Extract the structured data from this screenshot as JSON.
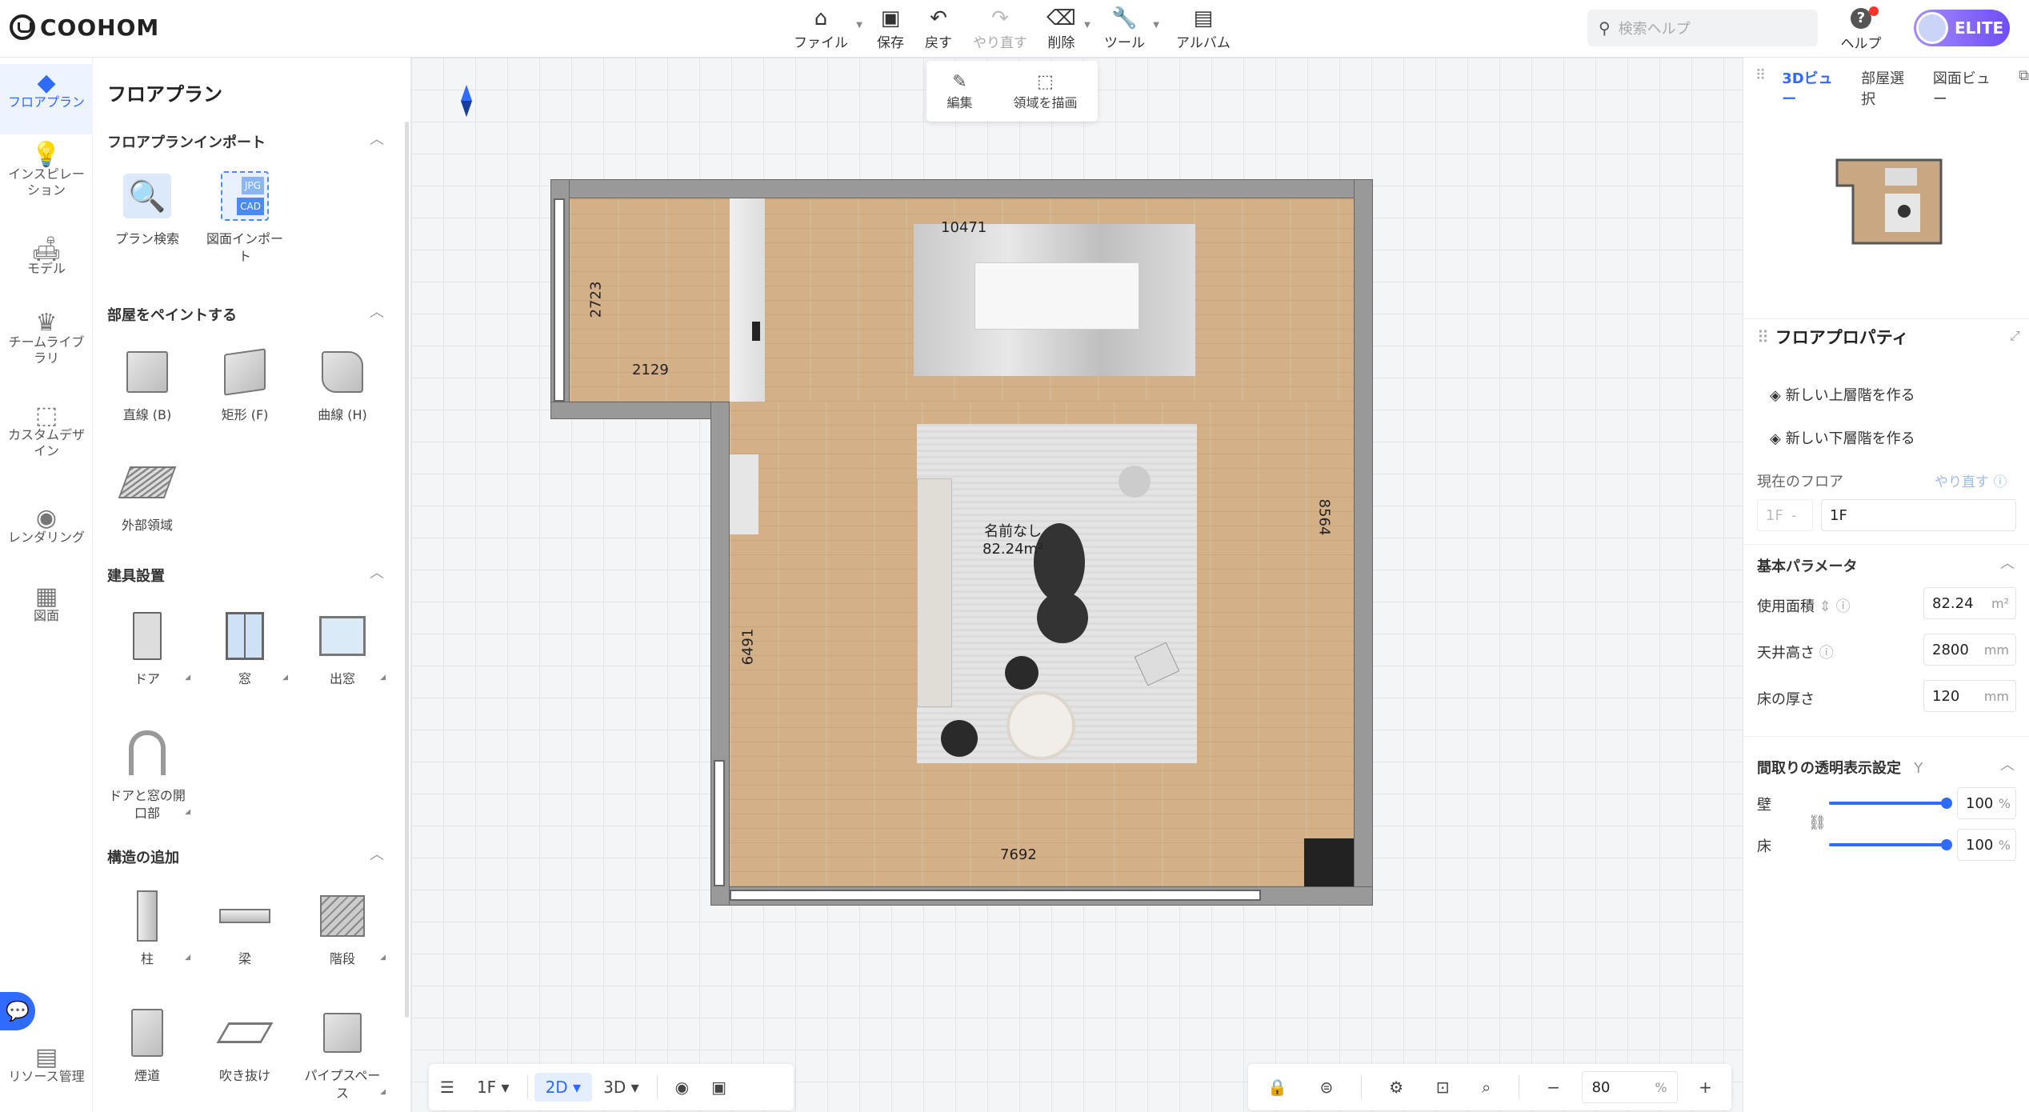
{
  "brand": "COOHOM",
  "toolbar": {
    "file": "ファイル",
    "save": "保存",
    "undo": "戻す",
    "redo": "やり直す",
    "delete": "削除",
    "tools": "ツール",
    "album": "アルバム"
  },
  "search": {
    "placeholder": "検索ヘルプ"
  },
  "help": "ヘルプ",
  "badge": "ELITE",
  "rail": [
    {
      "label": "フロアプラン",
      "icon": "floorplan-icon"
    },
    {
      "label": "インスピレーション",
      "icon": "lightbulb-icon"
    },
    {
      "label": "モデル",
      "icon": "sofa-icon"
    },
    {
      "label": "チームライブラリ",
      "icon": "crown-icon"
    },
    {
      "label": "カスタムデザイン",
      "icon": "box-icon"
    },
    {
      "label": "レンダリング",
      "icon": "camera-icon"
    },
    {
      "label": "図面",
      "icon": "drawing-icon"
    },
    {
      "label": "リソース管理",
      "icon": "resource-icon"
    }
  ],
  "panel": {
    "title": "フロアプラン",
    "import_section": "フロアプランインポート",
    "plan_search": "プラン検索",
    "drawing_import": "図面インポート",
    "paint_section": "部屋をペイントする",
    "straight": "直線 (B)",
    "rect": "矩形 (F)",
    "curve": "曲線 (H)",
    "exterior": "外部領域",
    "fixtures_section": "建具設置",
    "door": "ドア",
    "window": "窓",
    "bay_window": "出窓",
    "opening": "ドアと窓の開口部",
    "structure_section": "構造の追加",
    "column": "柱",
    "beam": "梁",
    "stairs": "階段",
    "chimney": "煙道",
    "void": "吹き抜け",
    "pipe_space": "パイプスペース"
  },
  "float_toolbar": {
    "edit": "編集",
    "draw_area": "領域を描画"
  },
  "plan": {
    "dims": {
      "top": "10471",
      "left_small": "2723",
      "ledge": "2129",
      "right": "8564",
      "left_large": "6491",
      "bottom": "7692"
    },
    "room_name": "名前なし",
    "room_area": "82.24m²"
  },
  "bottom_left": {
    "floor": "1F",
    "mode_2d": "2D",
    "mode_3d": "3D"
  },
  "zoom": {
    "value": "80",
    "unit": "%"
  },
  "right_panel": {
    "tabs": [
      "3Dビュー",
      "部屋選択",
      "図面ビュー"
    ],
    "title": "フロアプロパティ",
    "new_upper": "新しい上層階を作る",
    "new_lower": "新しい下層階を作る",
    "current_floor_label": "現在のフロア",
    "redo_link": "やり直す",
    "floor_code": "1F",
    "floor_dash": "-",
    "floor_value": "1F",
    "basic_params": "基本パラメータ",
    "area_label": "使用面積",
    "area_value": "82.24",
    "area_unit": "m²",
    "ceiling_label": "天井高さ",
    "ceiling_value": "2800",
    "ceiling_unit": "mm",
    "floor_thick_label": "床の厚さ",
    "floor_thick_value": "120",
    "floor_thick_unit": "mm",
    "transparency": "間取りの透明表示設定",
    "transparency_suffix": "Y",
    "wall_label": "壁",
    "wall_value": "100",
    "floor_label": "床",
    "floor_value2": "100",
    "percent": "%"
  }
}
